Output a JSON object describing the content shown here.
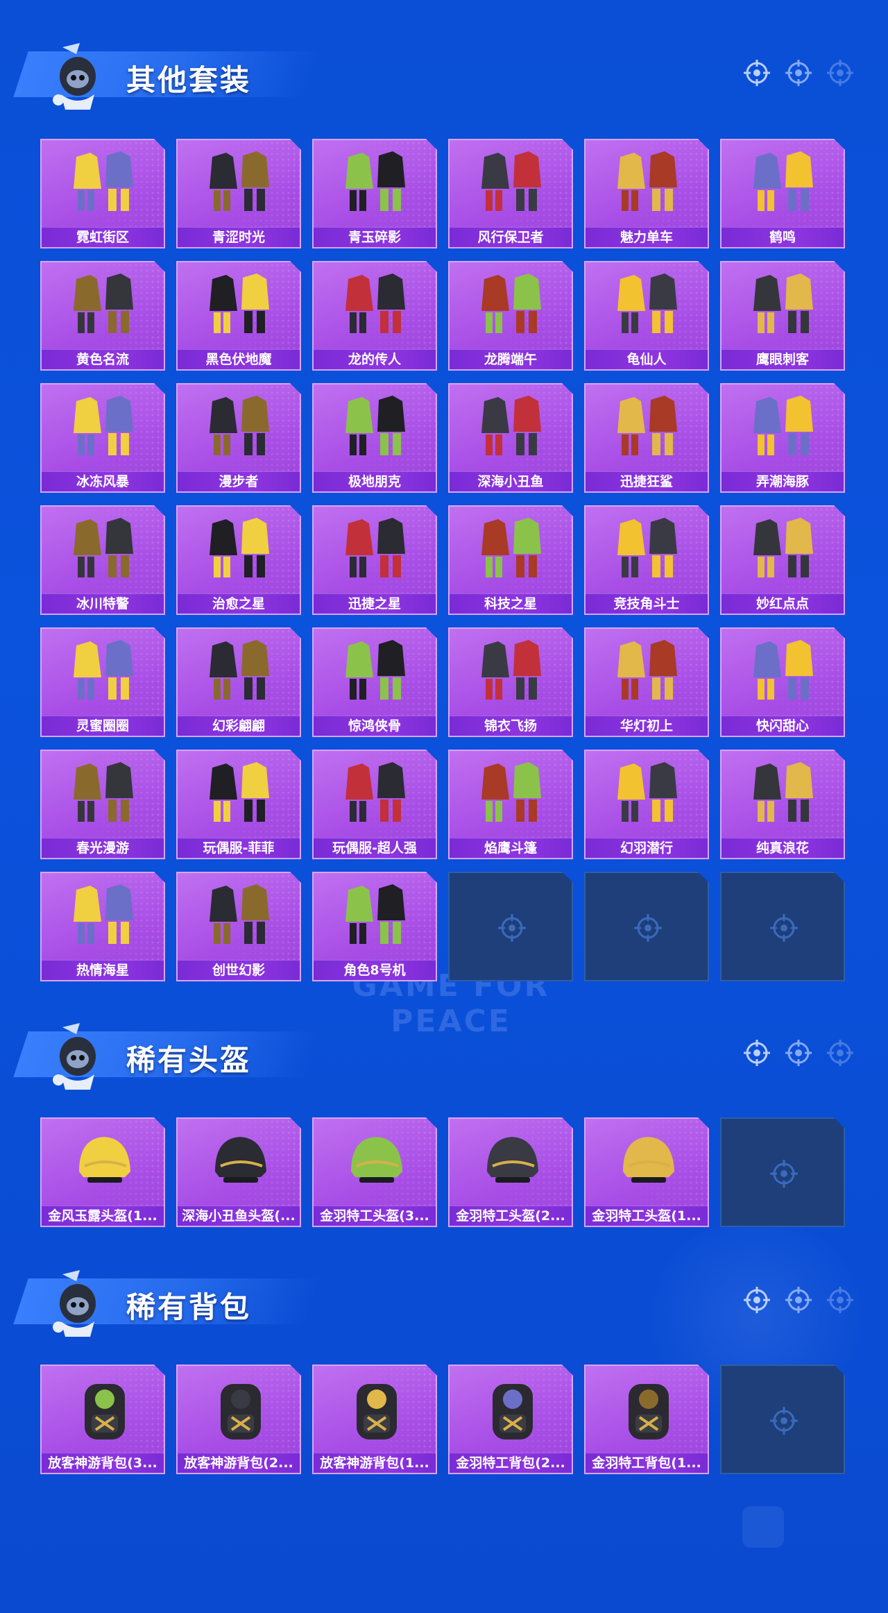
{
  "sections": [
    {
      "title": "其他套装",
      "items": [
        "霓虹街区",
        "青涩时光",
        "青玉碎影",
        "风行保卫者",
        "魅力单车",
        "鹤鸣",
        "黄色名流",
        "黑色伏地魔",
        "龙的传人",
        "龙腾端午",
        "龟仙人",
        "鹰眼刺客",
        "冰冻风暴",
        "漫步者",
        "极地朋克",
        "深海小丑鱼",
        "迅捷狂鲨",
        "弄潮海豚",
        "冰川特警",
        "治愈之星",
        "迅捷之星",
        "科技之星",
        "竞技角斗士",
        "妙红点点",
        "灵蜜圈圈",
        "幻彩翩翩",
        "惊鸿侠骨",
        "锦衣飞扬",
        "华灯初上",
        "快闪甜心",
        "春光漫游",
        "玩偶服-菲菲",
        "玩偶服-超人强",
        "焰鹰斗篷",
        "幻羽潜行",
        "纯真浪花",
        "热情海星",
        "创世幻影",
        "角色8号机"
      ],
      "empty_slots": 3
    },
    {
      "title": "稀有头盔",
      "items": [
        "金风玉露头盔(1...",
        "深海小丑鱼头盔(...",
        "金羽特工头盔(3...",
        "金羽特工头盔(2...",
        "金羽特工头盔(1..."
      ],
      "empty_slots": 1
    },
    {
      "title": "稀有背包",
      "items": [
        "放客神游背包(3...",
        "放客神游背包(2...",
        "放客神游背包(1...",
        "金羽特工背包(2...",
        "金羽特工背包(1..."
      ],
      "empty_slots": 1
    }
  ],
  "watermark": "GAME FOR PEACE",
  "colors": {
    "background": "#0b52dc",
    "card": "#a84ee6",
    "label_bar": "#7a2bd6",
    "empty_card": "#1e3f7a"
  },
  "icons": {
    "header_decor": "crosshair-icon",
    "empty_slot": "crosshair-icon",
    "mascot": "mascot-icon"
  }
}
